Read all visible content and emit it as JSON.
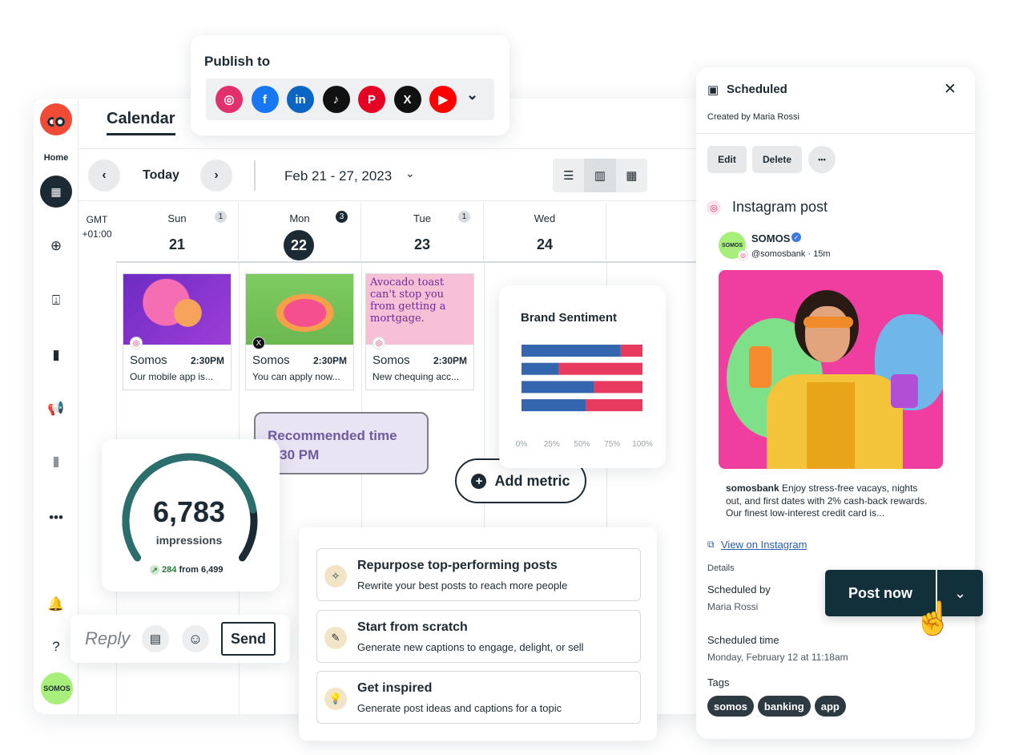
{
  "publish": {
    "title": "Publish to",
    "networks": [
      {
        "name": "instagram-icon",
        "color": "#e1306c",
        "glyph": "◎"
      },
      {
        "name": "facebook-icon",
        "color": "#1877f2",
        "glyph": "f"
      },
      {
        "name": "linkedin-icon",
        "color": "#0a66c2",
        "glyph": "in"
      },
      {
        "name": "tiktok-icon",
        "color": "#111111",
        "glyph": "♪"
      },
      {
        "name": "pinterest-icon",
        "color": "#e60023",
        "glyph": "P"
      },
      {
        "name": "x-icon",
        "color": "#111111",
        "glyph": "X"
      },
      {
        "name": "youtube-icon",
        "color": "#ff0000",
        "glyph": "▶"
      }
    ]
  },
  "sidebar": {
    "home": "Home",
    "avatar": "SOMOS"
  },
  "calendar": {
    "tab": "Calendar",
    "today": "Today",
    "range": "Feb 21 - 27, 2023",
    "gmt": "GMT +01:00",
    "days": [
      {
        "name": "Sun",
        "num": "21",
        "count": "1"
      },
      {
        "name": "Mon",
        "num": "22",
        "count": "3"
      },
      {
        "name": "Tue",
        "num": "23",
        "count": "1"
      },
      {
        "name": "Wed",
        "num": "24",
        "count": ""
      }
    ],
    "posts": [
      {
        "account": "Somos",
        "time": "2:30PM",
        "text": "Our mobile app is..."
      },
      {
        "account": "Somos",
        "time": "2:30PM",
        "text": "You can apply now..."
      },
      {
        "account": "Somos",
        "time": "2:30PM",
        "text": "New chequing acc...",
        "headline": "Avocado toast can't stop you from getting a mortgage."
      }
    ]
  },
  "recommended": {
    "line1": "Recommended time",
    "line2": "2:30 PM"
  },
  "add_metric": "Add metric",
  "impressions": {
    "value": "6,783",
    "label": "impressions",
    "delta": "284",
    "from": "from",
    "prev": "6,499",
    "progress": 0.82
  },
  "reply": {
    "placeholder": "Reply",
    "send": "Send"
  },
  "chart_data": {
    "type": "bar",
    "title": "Brand Sentiment",
    "orientation": "horizontal-stacked",
    "xticks": [
      "0%",
      "25%",
      "50%",
      "75%",
      "100%"
    ],
    "xlim": [
      0,
      100
    ],
    "series": [
      {
        "color": "#3466b0",
        "values": [
          82,
          31,
          60,
          53
        ]
      },
      {
        "color": "#e8395e",
        "values": [
          18,
          69,
          40,
          47
        ]
      }
    ]
  },
  "ideas": [
    {
      "title": "Repurpose top-performing posts",
      "desc": "Rewrite your best posts to reach more people",
      "icon": "wand-icon"
    },
    {
      "title": "Start from scratch",
      "desc": "Generate new captions to engage, delight, or sell",
      "icon": "pencil-icon"
    },
    {
      "title": "Get inspired",
      "desc": "Generate post ideas and captions for a topic",
      "icon": "lightbulb-icon"
    }
  ],
  "panel": {
    "status": "Scheduled",
    "created_by": "Created by Maria Rossi",
    "edit": "Edit",
    "delete": "Delete",
    "more": "•••",
    "post_type": "Instagram post",
    "account_name": "SOMOS",
    "handle": "@somosbank · 15m",
    "avatar": "SOMOS",
    "caption_user": "somosbank",
    "caption": "Enjoy stress-free vacays, nights out, and first dates with 2% cash-back rewards. Our finest low-interest credit card is...",
    "view_link": "View on Instagram",
    "details_label": "Details",
    "scheduled_by_label": "Scheduled by",
    "scheduled_by": "Maria Rossi",
    "scheduled_time_label": "Scheduled time",
    "scheduled_time": "Monday, February 12 at 11:18am",
    "tags_label": "Tags",
    "tags": [
      "somos",
      "banking",
      "app"
    ],
    "post_now": "Post now"
  },
  "colors": {
    "dark": "#1c2a33",
    "lavender": "#e9e4f4",
    "purple_text": "#6e5a9e",
    "teal": "#2a6e6e"
  }
}
